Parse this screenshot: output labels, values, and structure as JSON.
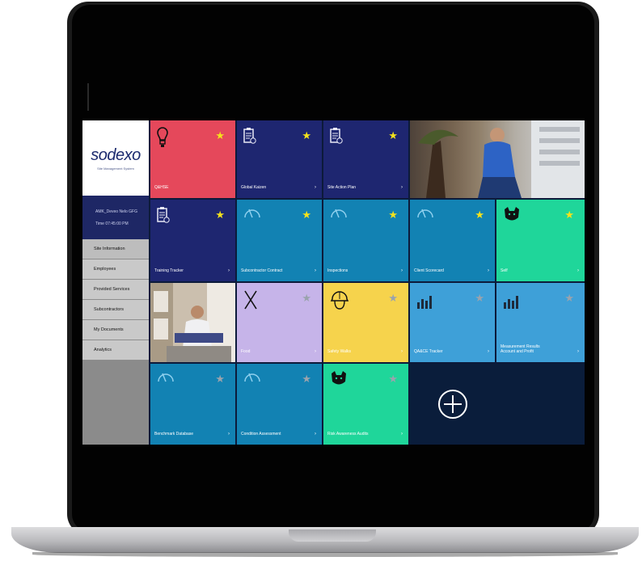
{
  "colors": {
    "red": "#e5485b",
    "navy": "#1e2670",
    "teal": "#1282b3",
    "green": "#1fd69a",
    "lavender": "#c6b4e9",
    "yellow": "#f6d34c",
    "light_blue": "#3ea0d8",
    "dark_navy": "#0a1d3b",
    "star_active": "#f4e21c",
    "star_inactive": "#9aa3ad"
  },
  "sidebar": {
    "logo": "sodexo",
    "logo_subtitle": "Site Management System",
    "user_line_1": "AMK_Deveo Nelo GFG",
    "user_line_2": "Time 07:45:00 PM",
    "items": [
      {
        "label": "Site Information"
      },
      {
        "label": "Employees"
      },
      {
        "label": "Provided Services"
      },
      {
        "label": "Subcontractors"
      },
      {
        "label": "My Documents"
      },
      {
        "label": "Analytics"
      }
    ]
  },
  "tiles": [
    {
      "label": "Q&HSE",
      "icon": "lightbulb-icon",
      "star": "active"
    },
    {
      "label": "Global Kaizen",
      "icon": "clipboard-icon",
      "star": "active"
    },
    {
      "label": "Site Action Plan",
      "icon": "clipboard-icon",
      "star": "active"
    },
    {
      "label": "",
      "icon": "photo-worker-image",
      "star": "none"
    },
    {
      "label": "Training Tracker",
      "icon": "clipboard-icon",
      "star": "active"
    },
    {
      "label": "Subcontractor Contract",
      "icon": "gauge-icon",
      "star": "active"
    },
    {
      "label": "Inspections",
      "icon": "gauge-icon",
      "star": "active"
    },
    {
      "label": "Client Scorecard",
      "icon": "gauge-icon",
      "star": "active"
    },
    {
      "label": "Self",
      "icon": "cat-icon",
      "star": "active"
    },
    {
      "label": "",
      "icon": "photo-office-image",
      "star": "none"
    },
    {
      "label": "Food",
      "icon": "cutlery-icon",
      "star": "inactive"
    },
    {
      "label": "Safety Walks",
      "icon": "hardhat-icon",
      "star": "inactive"
    },
    {
      "label": "QA&CE Tracker",
      "icon": "bar-chart-icon",
      "star": "inactive"
    },
    {
      "label": "Measurement Results Account and Profit",
      "icon": "bar-chart-icon",
      "star": "inactive"
    },
    {
      "label": "Benchmark Database",
      "icon": "gauge-icon",
      "star": "inactive"
    },
    {
      "label": "Condition Assessment",
      "icon": "gauge-icon",
      "star": "inactive"
    },
    {
      "label": "Risk Awareness Audits",
      "icon": "cat-icon",
      "star": "inactive"
    }
  ],
  "add_button": {
    "icon": "plus-circle-icon"
  },
  "glyphs": {
    "star": "★",
    "arrow": "›",
    "plus": "+"
  }
}
